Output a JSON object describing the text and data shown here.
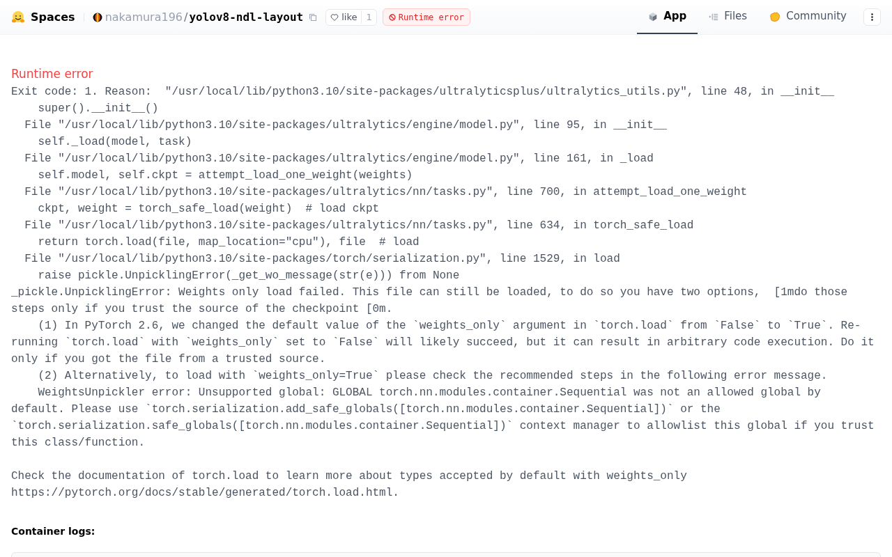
{
  "header": {
    "brand": "Spaces",
    "owner": "nakamura196",
    "separator": "/",
    "repo": "yolov8-ndl-layout",
    "like": {
      "label": "like",
      "count": "1"
    },
    "status": {
      "label": "Runtime error",
      "kind": "error"
    }
  },
  "tabs": [
    {
      "label": "App",
      "kind": "app",
      "selected": true
    },
    {
      "label": "Files",
      "kind": "files",
      "selected": false
    },
    {
      "label": "Community",
      "kind": "community",
      "selected": false
    }
  ],
  "error": {
    "title": "Runtime error",
    "blocks": [
      [
        "Exit code: 1. Reason:  \"/usr/local/lib/python3.10/site-packages/ultralyticsplus/ultralytics_utils.py\", line 48, in __init__",
        "    super().__init__()",
        "  File \"/usr/local/lib/python3.10/site-packages/ultralytics/engine/model.py\", line 95, in __init__",
        "    self._load(model, task)",
        "  File \"/usr/local/lib/python3.10/site-packages/ultralytics/engine/model.py\", line 161, in _load",
        "    self.model, self.ckpt = attempt_load_one_weight(weights)",
        "  File \"/usr/local/lib/python3.10/site-packages/ultralytics/nn/tasks.py\", line 700, in attempt_load_one_weight",
        "    ckpt, weight = torch_safe_load(weight)  # load ckpt",
        "  File \"/usr/local/lib/python3.10/site-packages/ultralytics/nn/tasks.py\", line 634, in torch_safe_load",
        "    return torch.load(file, map_location=\"cpu\"), file  # load",
        "  File \"/usr/local/lib/python3.10/site-packages/torch/serialization.py\", line 1529, in load",
        "    raise pickle.UnpicklingError(_get_wo_message(str(e))) from None",
        "_pickle.UnpicklingError: Weights only load failed. This file can still be loaded, to do so you have two options,  [1mdo those",
        "steps only if you trust the source of the checkpoint [0m.",
        "    (1) In PyTorch 2.6, we changed the default value of the `weights_only` argument in `torch.load` from `False` to `True`. Re-",
        "running `torch.load` with `weights_only` set to `False` will likely succeed, but it can result in arbitrary code execution. Do it",
        "only if you got the file from a trusted source.",
        "    (2) Alternatively, to load with `weights_only=True` please check the recommended steps in the following error message.",
        "    WeightsUnpickler error: Unsupported global: GLOBAL torch.nn.modules.container.Sequential was not an allowed global by",
        "default. Please use `torch.serialization.add_safe_globals([torch.nn.modules.container.Sequential])` or the",
        "`torch.serialization.safe_globals([torch.nn.modules.container.Sequential])` context manager to allowlist this global if you trust",
        "this class/function."
      ],
      [
        "Check the documentation of torch.load to learn more about types accepted by default with weights_only",
        "https://pytorch.org/docs/stable/generated/torch.load.html."
      ]
    ]
  },
  "logs": {
    "title": "Container logs:"
  }
}
